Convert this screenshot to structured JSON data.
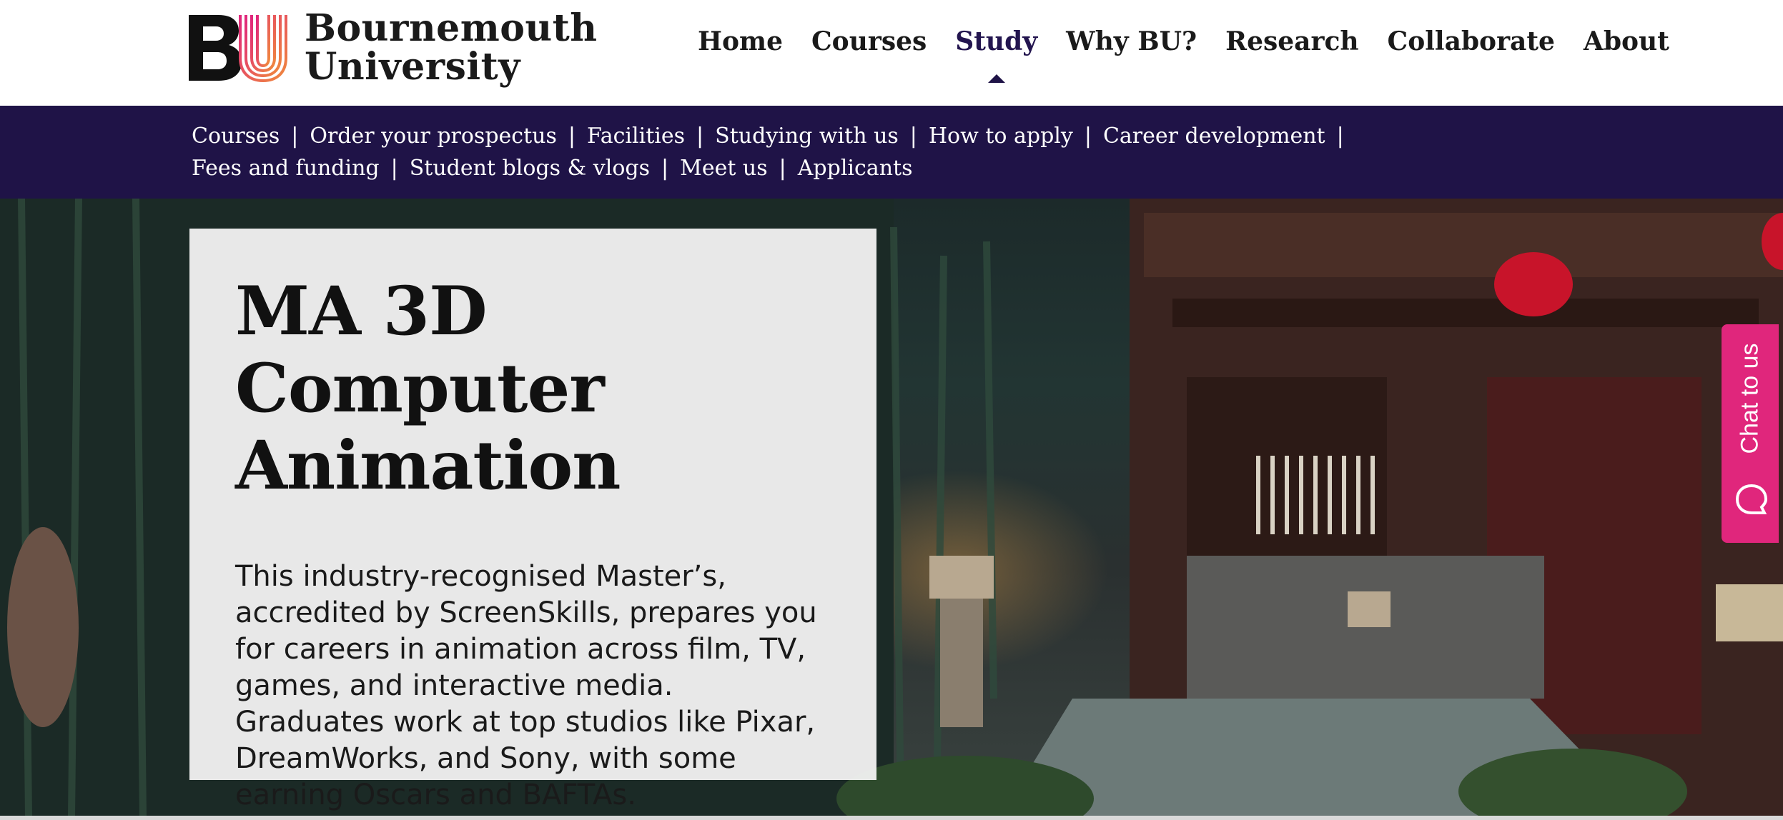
{
  "header": {
    "logo_line1": "Bournemouth",
    "logo_line2": "University",
    "nav": [
      {
        "label": "Home"
      },
      {
        "label": "Courses"
      },
      {
        "label": "Study",
        "active": true
      },
      {
        "label": "Why BU?"
      },
      {
        "label": "Research"
      },
      {
        "label": "Collaborate"
      },
      {
        "label": "About"
      }
    ]
  },
  "subnav": {
    "items": [
      {
        "label": "Courses"
      },
      {
        "label": "Order your prospectus"
      },
      {
        "label": "Facilities"
      },
      {
        "label": "Studying with us"
      },
      {
        "label": "How to apply"
      },
      {
        "label": "Career development"
      },
      {
        "label": "Fees and funding"
      },
      {
        "label": "Student blogs & vlogs"
      },
      {
        "label": "Meet us"
      },
      {
        "label": "Applicants"
      }
    ],
    "separator": "|"
  },
  "hero": {
    "title_line1": "MA 3D Computer",
    "title_line2": "Animation",
    "description": "This industry-recognised Master’s, accredited by ScreenSkills, prepares you for careers in animation across film, TV, games, and interactive media. Graduates work at top studios like Pixar, DreamWorks, and Sony, with some earning Oscars and BAFTAs."
  },
  "chat": {
    "label": "Chat to us",
    "icon": "chat-bubble-icon"
  },
  "colors": {
    "brand_dark": "#1f1347",
    "nav_active": "#23154f",
    "chat_pink": "#e0267c",
    "logo_u_gradient": [
      "#e0267c",
      "#f08a3c"
    ]
  }
}
